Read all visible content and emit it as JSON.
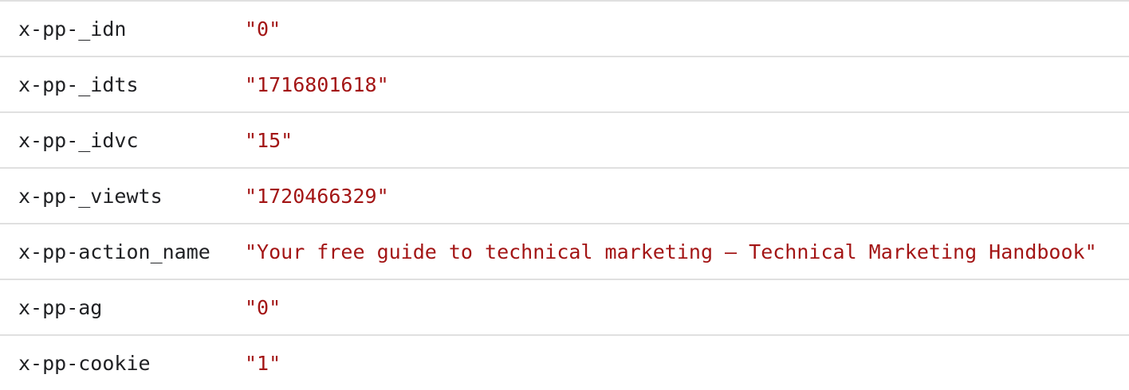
{
  "rows": [
    {
      "key": "x-pp-_idn",
      "value": "\"0\""
    },
    {
      "key": "x-pp-_idts",
      "value": "\"1716801618\""
    },
    {
      "key": "x-pp-_idvc",
      "value": "\"15\""
    },
    {
      "key": "x-pp-_viewts",
      "value": "\"1720466329\""
    },
    {
      "key": "x-pp-action_name",
      "value": "\"Your free guide to technical marketing – Technical Marketing Handbook\""
    },
    {
      "key": "x-pp-ag",
      "value": "\"0\""
    },
    {
      "key": "x-pp-cookie",
      "value": "\"1\""
    }
  ],
  "colors": {
    "key_text": "#202124",
    "value_text": "#a31515",
    "divider": "#e0e0e0"
  }
}
